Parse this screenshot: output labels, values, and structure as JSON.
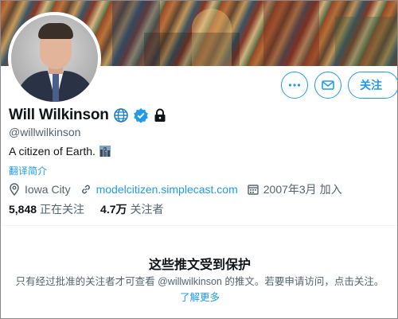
{
  "profile": {
    "display_name": "Will Wilkinson",
    "handle": "@willwilkinson",
    "bio": "A citizen of Earth.",
    "translate_label": "翻译简介",
    "location": "Iowa City",
    "website": "modelcitizen.simplecast.com",
    "joined": "2007年3月 加入",
    "following_count": "5,848",
    "following_label": "正在关注",
    "followers_count": "4.7万",
    "followers_label": "关注者"
  },
  "actions": {
    "follow_label": "关注"
  },
  "protected": {
    "title": "这些推文受到保护",
    "text": "只有经过批准的关注者才可查看 @willwilkinson 的推文。若要申请访问，点击关注。",
    "link": "了解更多"
  },
  "icons": {
    "more": "more-icon",
    "message": "message-icon",
    "globe": "globe-icon",
    "verified": "verified-badge-icon",
    "lock": "lock-icon",
    "location": "location-pin-icon",
    "link": "link-icon",
    "calendar": "calendar-icon",
    "emoji": "cityscape-emoji-icon"
  },
  "colors": {
    "accent": "#1d9bf0",
    "text": "#0f1419",
    "muted": "#536471"
  }
}
